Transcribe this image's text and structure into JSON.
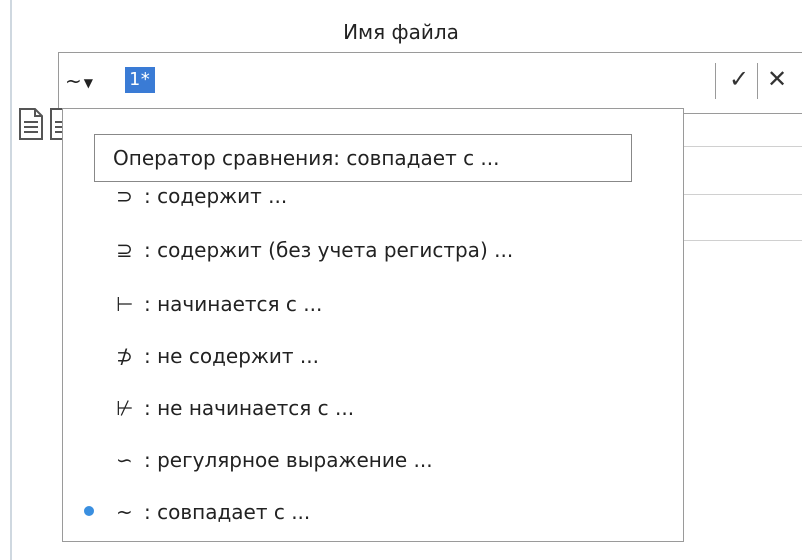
{
  "header": {
    "title": "Имя файла"
  },
  "filter": {
    "operator_symbol": "~",
    "value": "1*"
  },
  "menu": {
    "tooltip": "Оператор сравнения: совпадает с ...",
    "items": [
      {
        "symbol": "⊃",
        "label": ": содержит ...",
        "selected": false
      },
      {
        "symbol": "⊇",
        "label": ": содержит (без учета регистра) ...",
        "selected": false
      },
      {
        "symbol": "⊢",
        "label": ": начинается с ...",
        "selected": false
      },
      {
        "symbol": "⊅",
        "label": ": не содержит ...",
        "selected": false
      },
      {
        "symbol": "⊬",
        "label": ": не начинается с ...",
        "selected": false
      },
      {
        "symbol": "∽",
        "label": ": регулярное выражение ...",
        "selected": false
      },
      {
        "symbol": "~",
        "label": ": совпадает с ...",
        "selected": true
      }
    ]
  },
  "icons": {
    "operator_dropdown": "chevron-down-icon",
    "apply": "check-icon",
    "clear": "close-icon",
    "file": "document-icon"
  },
  "colors": {
    "selection": "#3a7bd5",
    "bullet": "#3a8fe0"
  }
}
